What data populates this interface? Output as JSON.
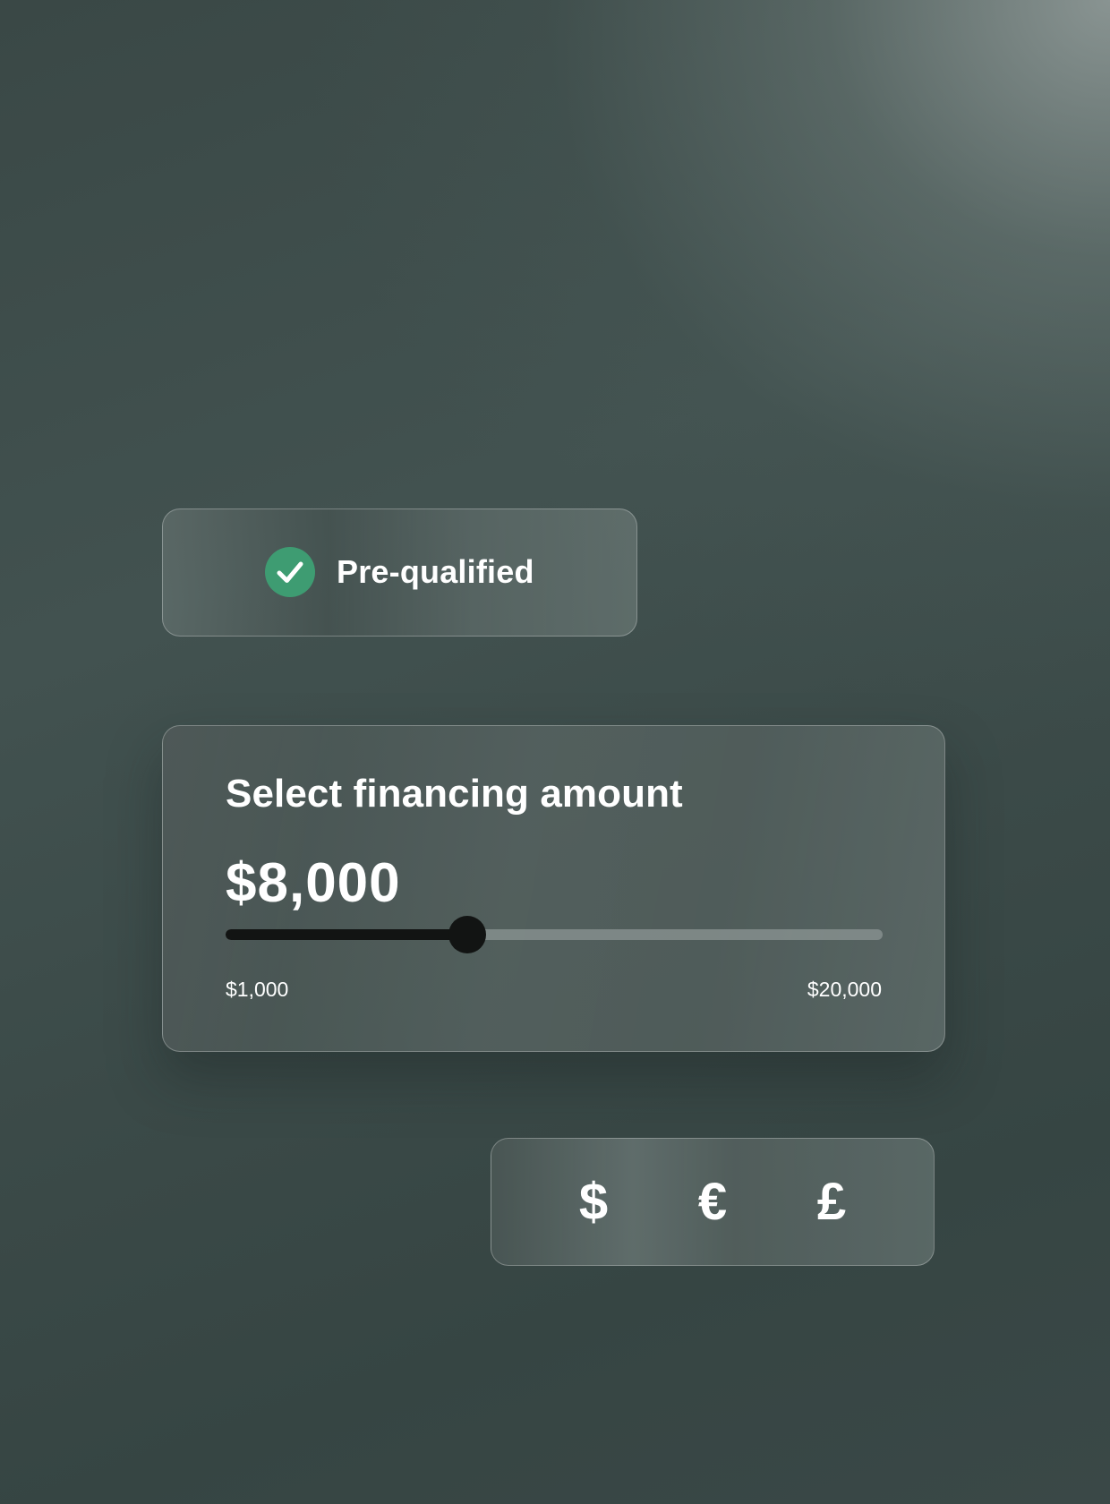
{
  "prequal": {
    "label": "Pre-qualified",
    "icon": "check-circle-icon",
    "icon_color": "#3e9c72"
  },
  "financing": {
    "title": "Select financing amount",
    "amount_display": "$8,000",
    "slider": {
      "min": 1000,
      "max": 20000,
      "value": 8000,
      "min_label": "$1,000",
      "max_label": "$20,000"
    }
  },
  "currencies": {
    "items": [
      {
        "symbol": "$",
        "name": "usd"
      },
      {
        "symbol": "€",
        "name": "eur"
      },
      {
        "symbol": "£",
        "name": "gbp"
      }
    ]
  },
  "colors": {
    "accent_green": "#3e9c72",
    "slider_fill": "#121413",
    "text": "#ffffff"
  }
}
